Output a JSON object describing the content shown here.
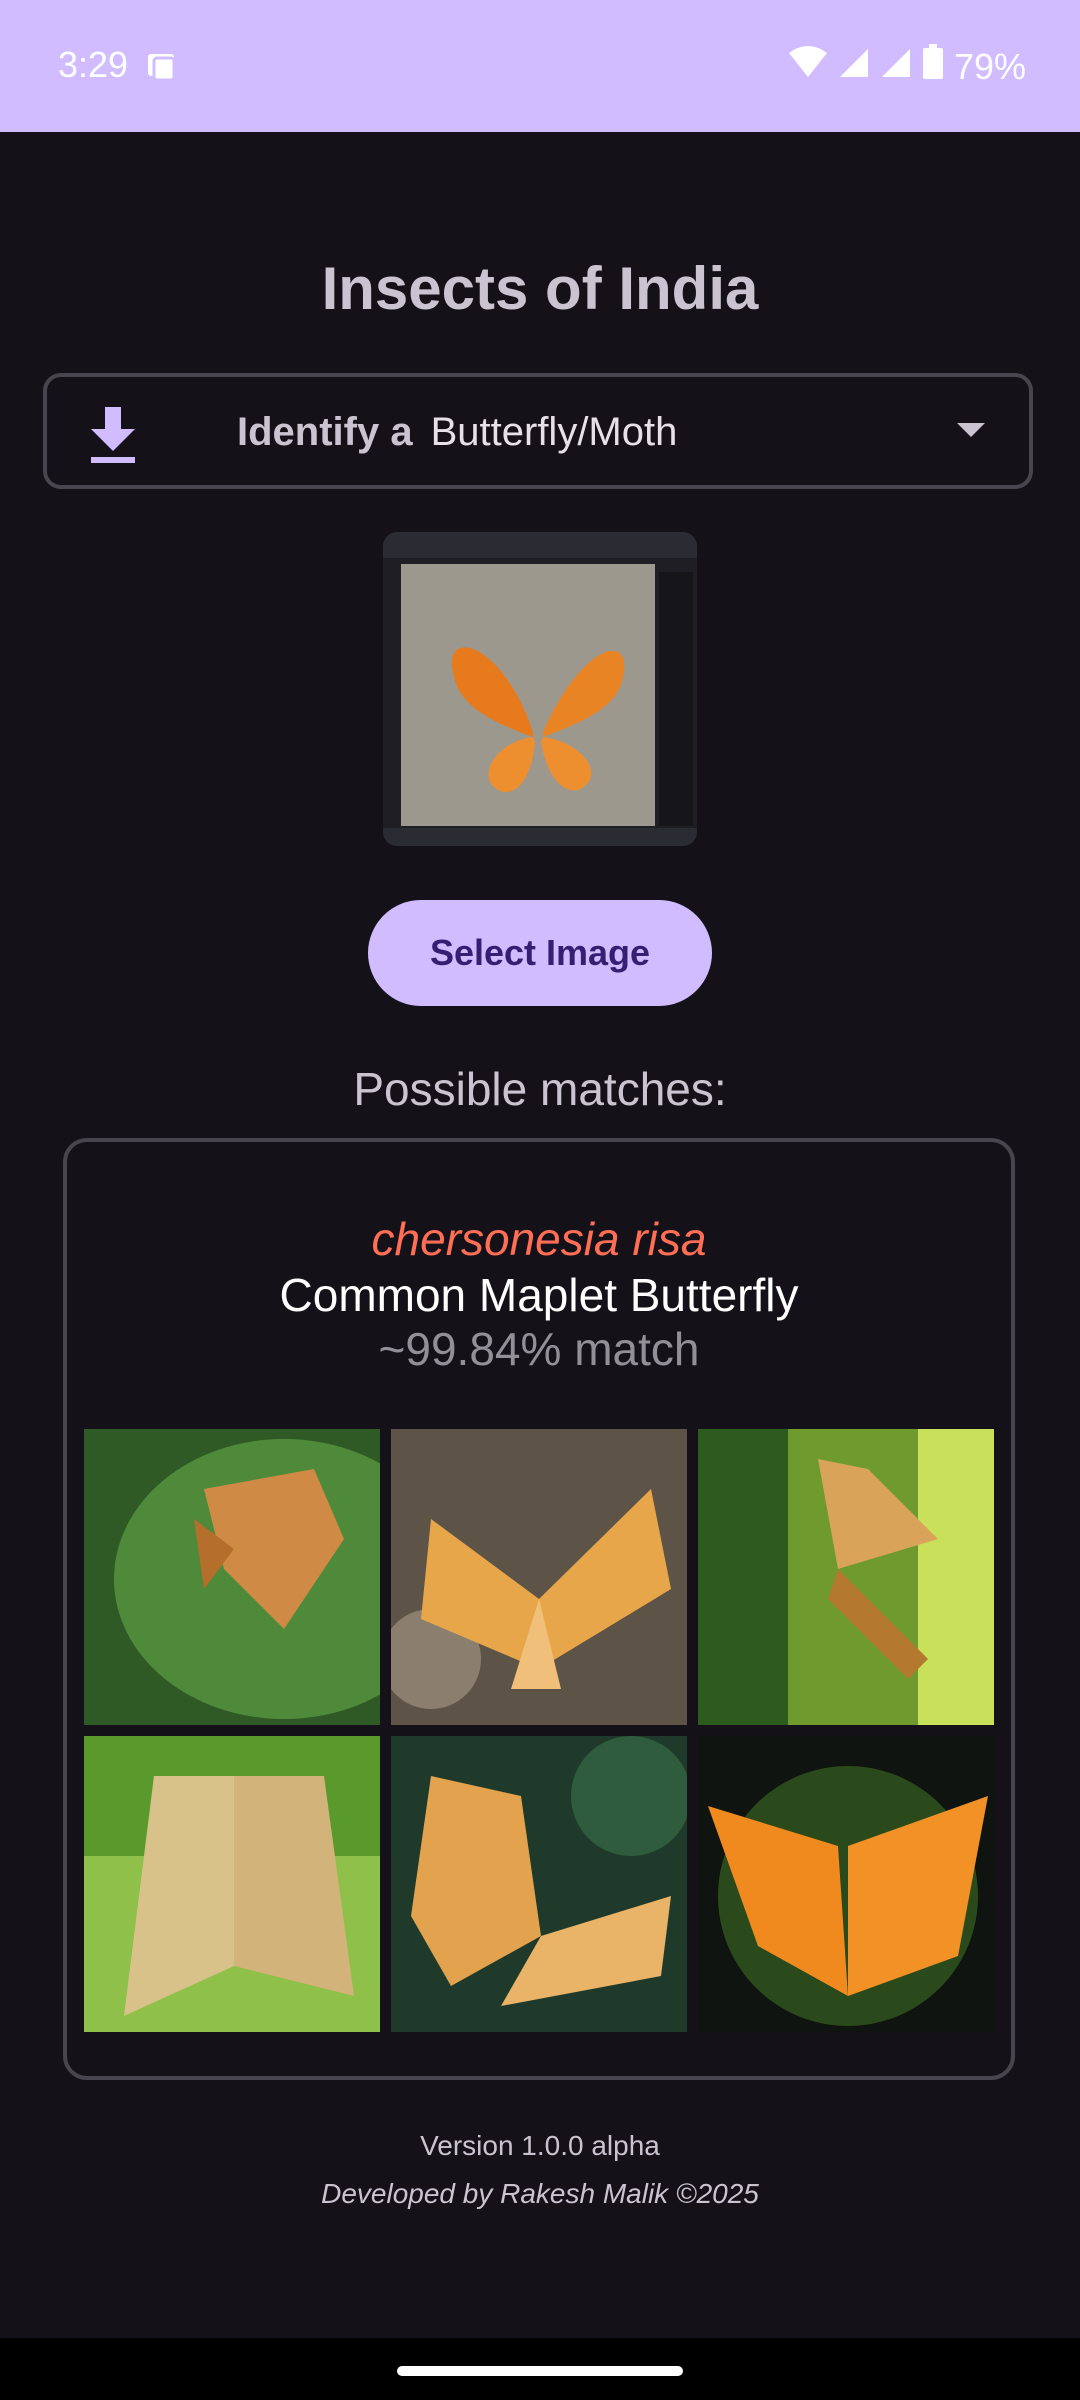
{
  "status_bar": {
    "time": "3:29",
    "battery": "79%",
    "bg_color": "#d0bcff"
  },
  "app": {
    "title": "Insects of India"
  },
  "selector": {
    "prefix": "Identify a",
    "value": "Butterfly/Moth",
    "icons": [
      "download-icon",
      "dropdown-arrow-icon"
    ]
  },
  "preview_image": {
    "label": "uploaded butterfly photo"
  },
  "select_button": {
    "label": "Select Image"
  },
  "results": {
    "heading": "Possible matches:",
    "match": {
      "scientific_name": "chersonesia risa",
      "common_name": "Common Maplet Butterfly",
      "confidence": "~99.84% match"
    },
    "reference_image_count": 6
  },
  "footer": {
    "version": "Version 1.0.0 alpha",
    "developer": "Developed by Rakesh Malik ©2025"
  },
  "colors": {
    "background": "#141218",
    "accent": "#d0bcff",
    "scientific_name": "#ff6e55",
    "outline": "#49454f"
  }
}
